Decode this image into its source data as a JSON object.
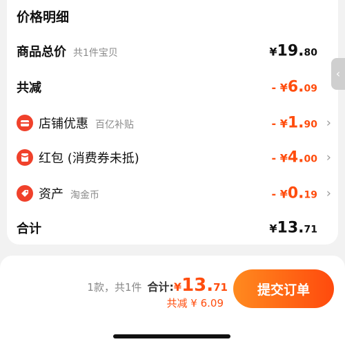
{
  "section_title": "价格明细",
  "rows": {
    "goods_total": {
      "label": "商品总价",
      "sub": "共1件宝贝",
      "sym": "¥",
      "int": "19.",
      "dec": "80"
    },
    "total_reduction": {
      "label": "共减",
      "sym": "- ¥",
      "int": "6.",
      "dec": "09"
    },
    "shop_discount": {
      "label": "店铺优惠",
      "sub": "百亿补贴",
      "sym": "- ¥",
      "int": "1.",
      "dec": "90",
      "icon": "shop-icon"
    },
    "red_packet": {
      "label": "红包 (消费券未抵)",
      "sym": "- ¥",
      "int": "4.",
      "dec": "00",
      "icon": "red-packet-icon"
    },
    "assets": {
      "label": "资产",
      "sub": "淘金币",
      "sym": "- ¥",
      "int": "0.",
      "dec": "19",
      "icon": "coin-tag-icon"
    },
    "total": {
      "label": "合计",
      "sym": "¥",
      "int": "13.",
      "dec": "71"
    }
  },
  "chevron": "›",
  "side_tab": "‹",
  "bottom_bar": {
    "count": "1款，共1件",
    "total_label": "合计:",
    "sym": "¥",
    "int": "13.",
    "dec": "71",
    "discount": "共减 ¥ 6.09",
    "submit_label": "提交订单"
  },
  "colors": {
    "accent": "#ff4d0e",
    "icon_red": "#f0412b",
    "button_start": "#ff8a1f",
    "button_end": "#ff4a0d"
  }
}
